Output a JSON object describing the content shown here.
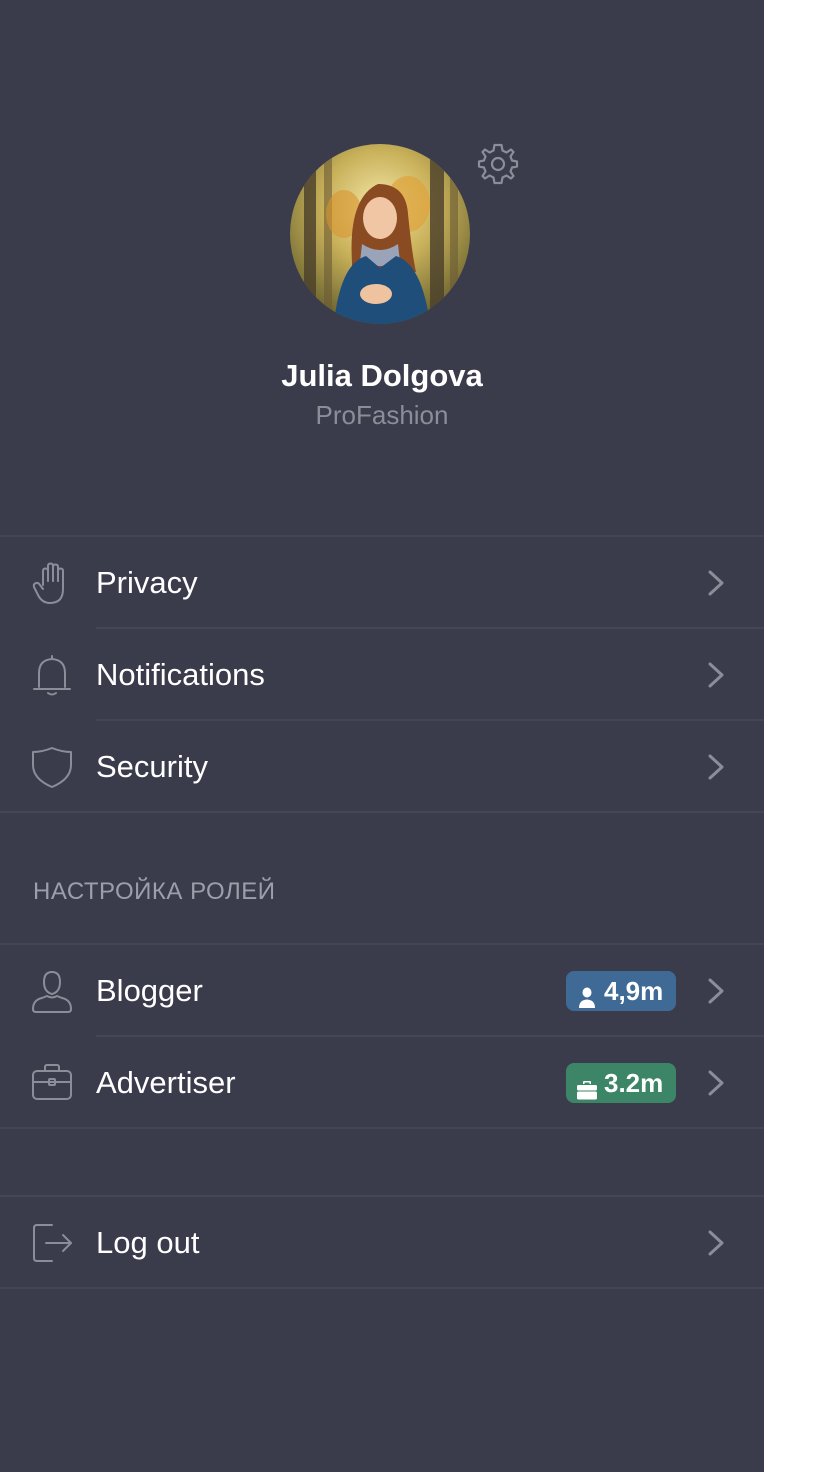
{
  "profile": {
    "name": "Julia Dolgova",
    "subtitle": "ProFashion"
  },
  "menu": [
    {
      "label": "Privacy",
      "icon": "hand-icon"
    },
    {
      "label": "Notifications",
      "icon": "bell-icon"
    },
    {
      "label": "Security",
      "icon": "shield-icon"
    }
  ],
  "roles": {
    "title": "НАСТРОЙКА РОЛЕЙ",
    "items": [
      {
        "label": "Blogger",
        "icon": "user-icon",
        "badge": "4,9m",
        "badge_icon": "person-icon",
        "badge_color": "#3f6a96"
      },
      {
        "label": "Advertiser",
        "icon": "briefcase-icon",
        "badge": "3.2m",
        "badge_icon": "briefcase-icon",
        "badge_color": "#3c8567"
      }
    ]
  },
  "logout": {
    "label": "Log out",
    "icon": "logout-icon"
  },
  "colors": {
    "background": "#3a3b4b",
    "divider": "#444556",
    "text": "#ffffff",
    "muted": "#8c8d99"
  }
}
